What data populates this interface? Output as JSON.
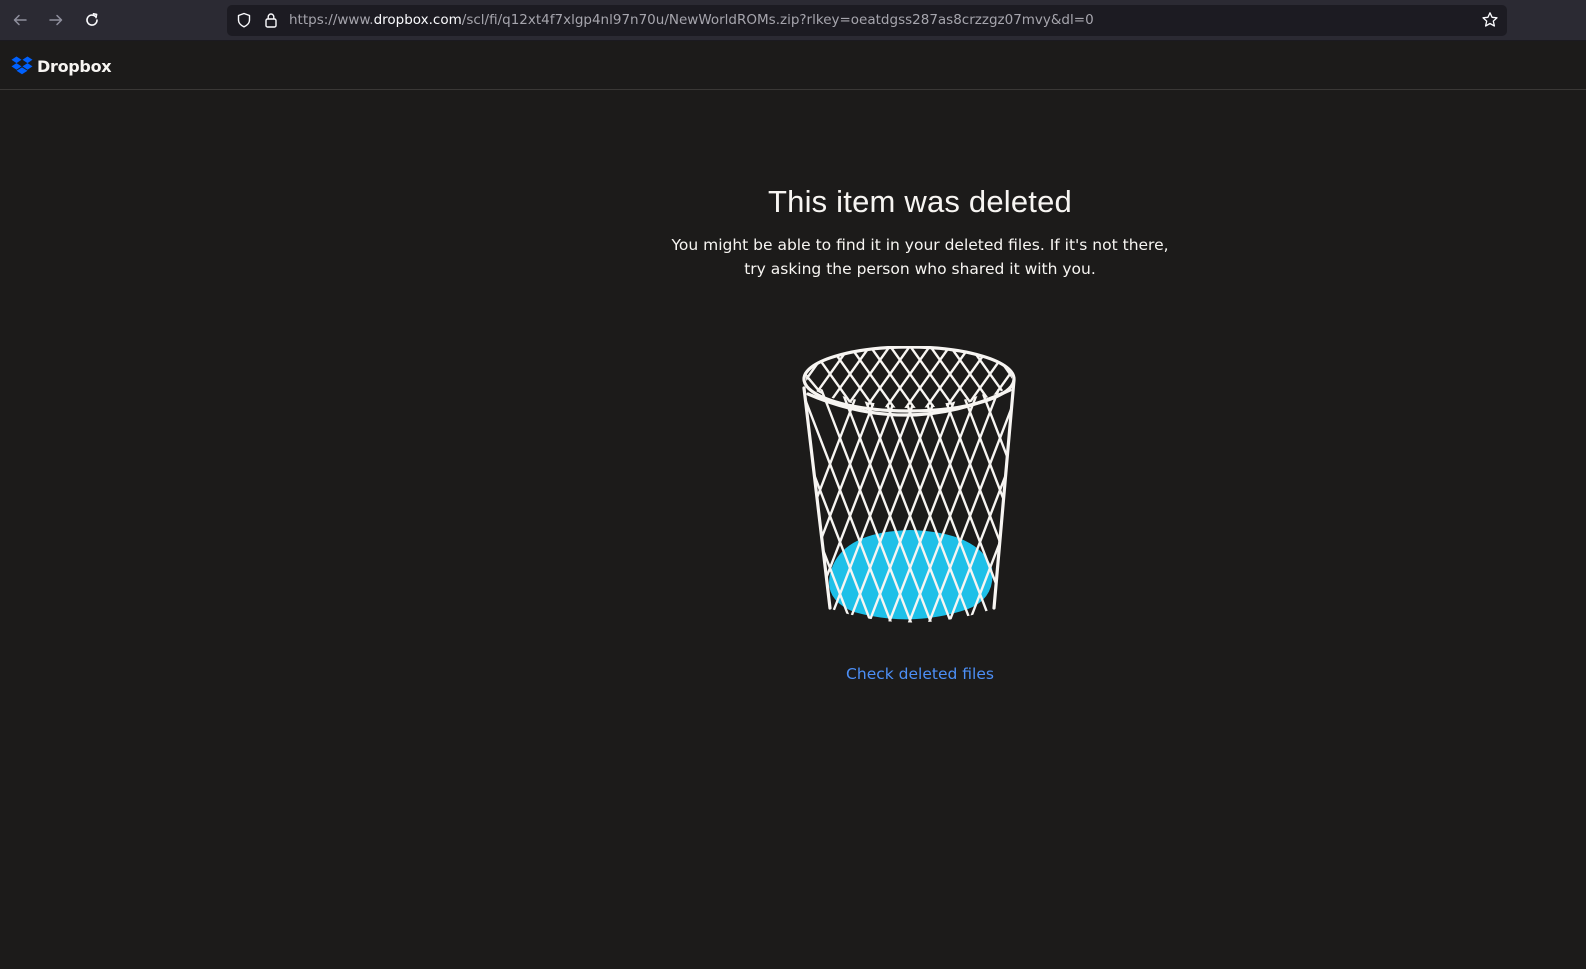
{
  "browser": {
    "url_prefix": "https://www.",
    "url_domain": "dropbox.com",
    "url_path": "/scl/fi/q12xt4f7xlgp4nl97n70u/NewWorldROMs.zip?rlkey=oeatdgss287as8crzzgz07mvy&dl=0",
    "icons": [
      "back-arrow-icon",
      "forward-arrow-icon",
      "reload-icon",
      "shield-icon",
      "lock-icon",
      "bookmark-star-icon"
    ]
  },
  "header": {
    "logo_text": "Dropbox",
    "logo_color": "#0061fe"
  },
  "main": {
    "title": "This item was deleted",
    "message": "You might be able to find it in your deleted files. If it's not there, try asking the person who shared it with you.",
    "link_label": "Check deleted files",
    "illustration": "trash-bin-illustration"
  },
  "colors": {
    "background": "#1c1b1a",
    "link": "#4c8ff7",
    "accent_blue": "#1ec0e8"
  }
}
